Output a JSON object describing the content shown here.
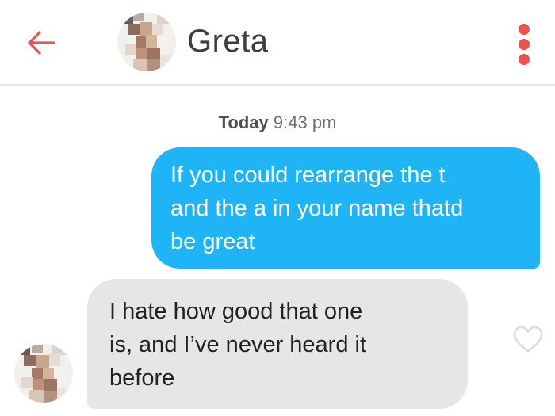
{
  "header": {
    "contact_name": "Greta",
    "back_icon": "arrow-left-icon",
    "menu_icon": "more-vertical-icon",
    "accent_color": "#e8534f"
  },
  "conversation": {
    "timestamp_day": "Today",
    "timestamp_time": "9:43 pm",
    "messages": [
      {
        "direction": "outgoing",
        "lines": [
          "If you could rearrange the t",
          "and the a in your name thatd",
          "be great"
        ],
        "bubble_color": "#1fb4f5"
      },
      {
        "direction": "incoming",
        "lines": [
          "I hate how good that one",
          "is, and I’ve never heard it",
          "before"
        ],
        "bubble_color": "#e6e6e6",
        "like_icon": "heart-outline-icon"
      }
    ]
  }
}
